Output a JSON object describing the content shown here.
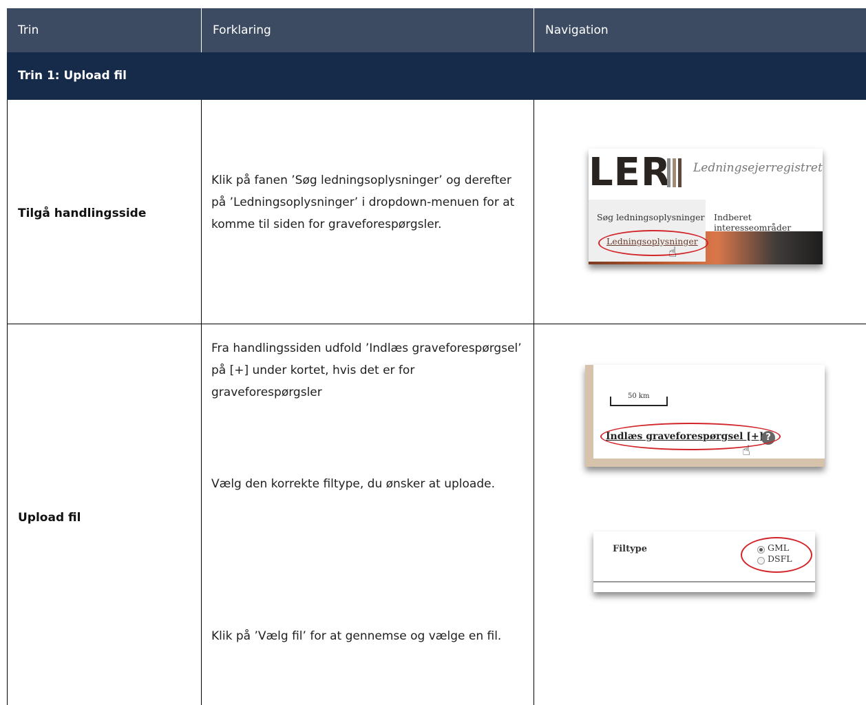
{
  "header": {
    "col_trin": "Trin",
    "col_forklaring": "Forklaring",
    "col_navigation": "Navigation"
  },
  "section": {
    "title": "Trin 1: Upload fil"
  },
  "rows": [
    {
      "label": "Tilgå handlingsside",
      "text": "Klik på fanen ’Søg ledningsoplysninger’ og derefter på ’Ledningsoplysninger’ i dropdown-menuen for at komme til siden for graveforespørgsler.",
      "screenshot": {
        "logo": "LER",
        "subtitle": "Ledningsejerregistret",
        "menu_item_1": "Søg ledningsoplysninger",
        "menu_item_2": "Indberet interesseområder",
        "dropdown_item": "Ledningsoplysninger"
      }
    },
    {
      "label": "Upload fil",
      "steps": [
        {
          "text": "Fra handlingssiden udfold ’Indlæs graveforespørgsel’ på [+] under kortet, hvis det er for graveforespørgsler",
          "screenshot": {
            "scale": "50 km",
            "link": "Indlæs graveforespørgsel [+]",
            "help": "?"
          }
        },
        {
          "text": "Vælg den korrekte filtype, du ønsker at uploade.",
          "screenshot": {
            "label": "Filtype",
            "options": [
              "GML",
              "DSFL"
            ],
            "selected": "GML"
          }
        },
        {
          "text": "Klik på ’Vælg fil’ for at gennemse og vælge en fil."
        }
      ]
    }
  ],
  "colors": {
    "header_bg": "#3c4b62",
    "section_bg": "#162a4a",
    "highlight_oval": "#d1252a"
  }
}
